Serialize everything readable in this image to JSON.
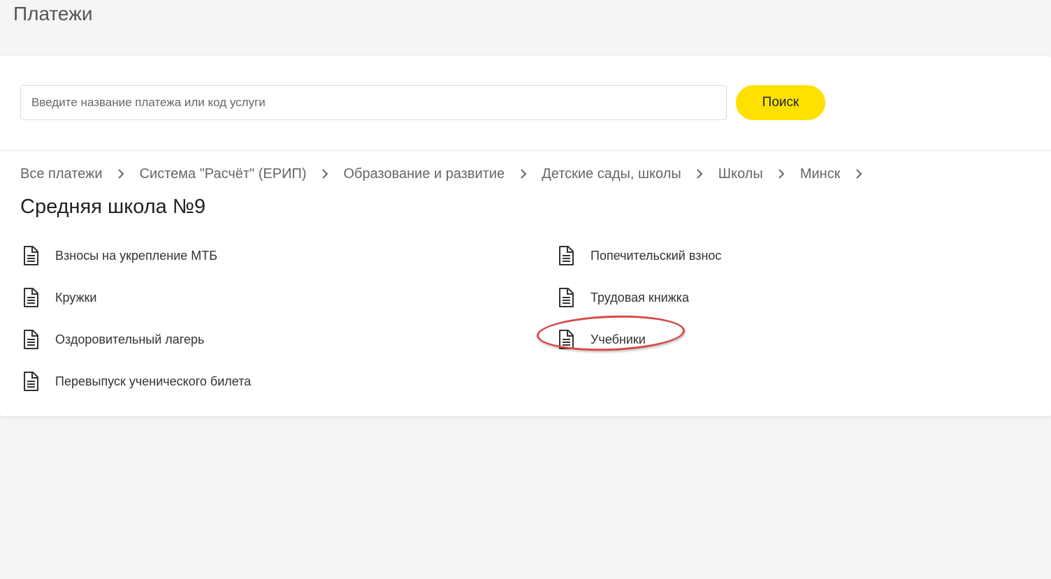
{
  "page": {
    "title": "Платежи"
  },
  "search": {
    "placeholder": "Введите название платежа или код услуги",
    "value": "",
    "button_label": "Поиск",
    "button_color": "#ffe100"
  },
  "breadcrumb": {
    "items": [
      {
        "label": "Все платежи"
      },
      {
        "label": "Система \"Расчёт\" (ЕРИП)"
      },
      {
        "label": "Образование и развитие"
      },
      {
        "label": "Детские сады, школы"
      },
      {
        "label": "Школы"
      },
      {
        "label": "Минск"
      }
    ],
    "separator_icon": "chevron-right-icon"
  },
  "section": {
    "title": "Средняя школа №9"
  },
  "services": {
    "icon": "document-icon",
    "left": [
      {
        "label": "Взносы на укрепление МТБ"
      },
      {
        "label": "Кружки"
      },
      {
        "label": "Оздоровительный лагерь"
      },
      {
        "label": "Перевыпуск ученического билета"
      }
    ],
    "right": [
      {
        "label": "Попечительский взнос"
      },
      {
        "label": "Трудовая книжка"
      },
      {
        "label": "Учебники"
      }
    ]
  },
  "annotation": {
    "highlighted_item": "Учебники",
    "color": "#d94848"
  }
}
